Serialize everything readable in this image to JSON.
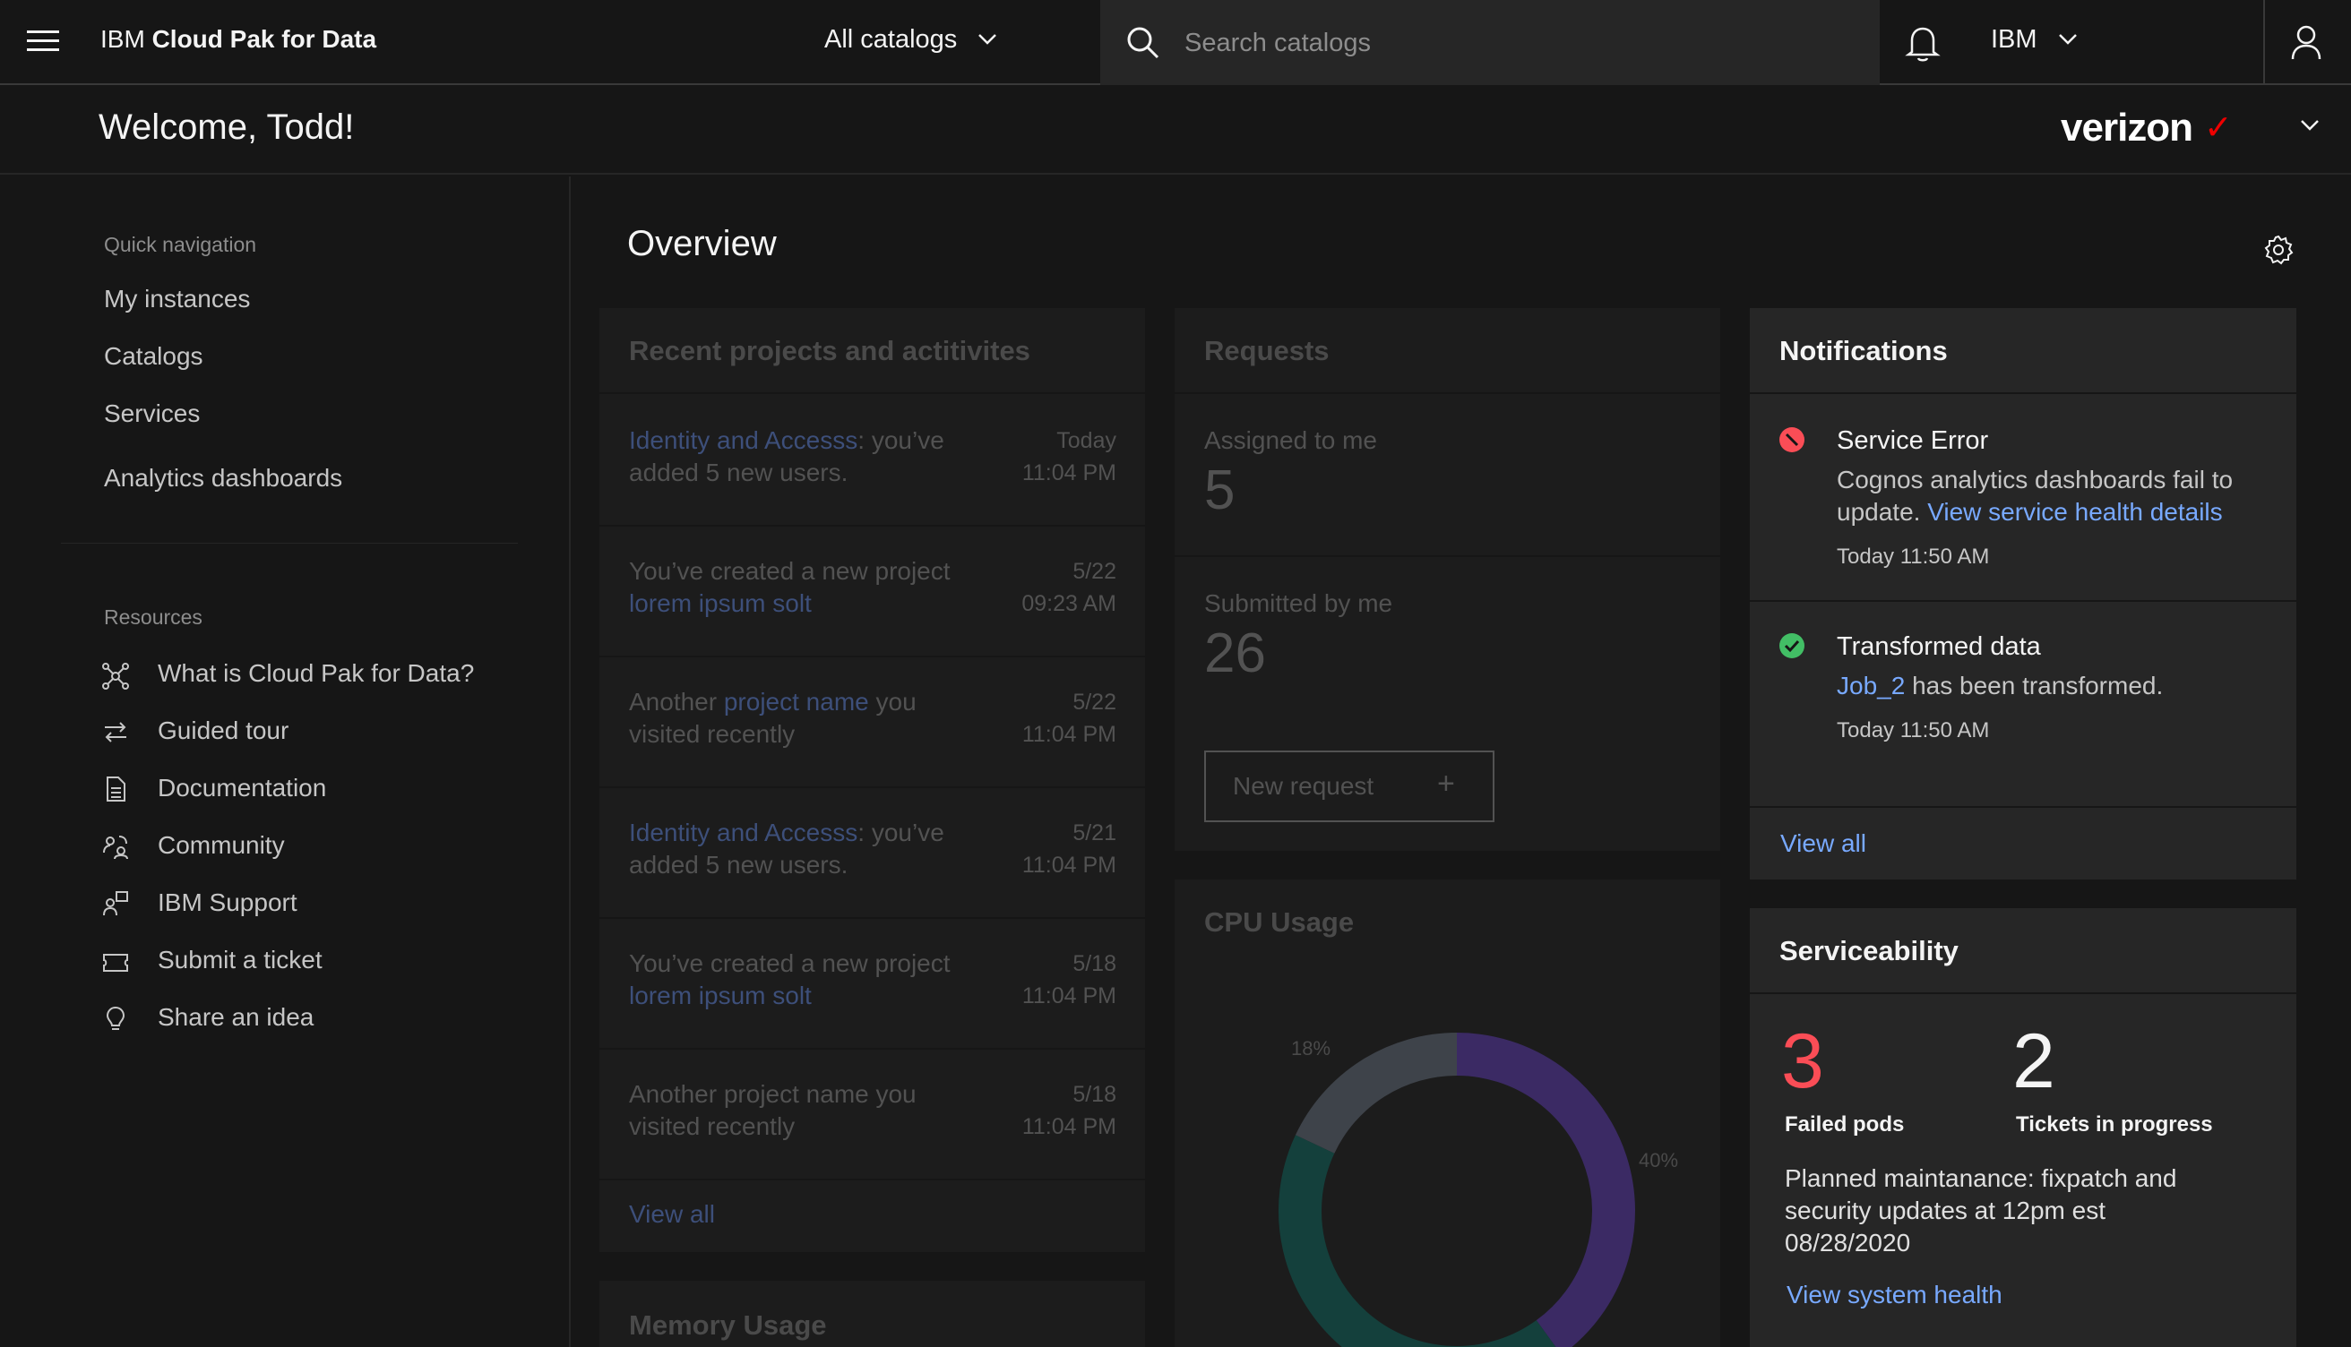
{
  "header": {
    "brand_prefix": "IBM",
    "brand_name": "Cloud Pak for Data",
    "catalog_selector": "All catalogs",
    "search_placeholder": "Search catalogs",
    "tenant": "IBM"
  },
  "welcome": {
    "greeting": "Welcome, Todd!",
    "org_logo_text": "verizon",
    "org_logo_mark": "✓"
  },
  "left_nav": {
    "quick_nav_label": "Quick navigation",
    "quick_items": [
      "My instances",
      "Catalogs",
      "Services",
      "Analytics dashboards"
    ],
    "resources_label": "Resources",
    "resources": [
      {
        "label": "What is Cloud Pak for Data?",
        "icon": "network-icon"
      },
      {
        "label": "Guided tour",
        "icon": "arrows-swap-icon"
      },
      {
        "label": "Documentation",
        "icon": "document-icon"
      },
      {
        "label": "Community",
        "icon": "community-icon"
      },
      {
        "label": "IBM Support",
        "icon": "support-icon"
      },
      {
        "label": "Submit a ticket",
        "icon": "ticket-icon"
      },
      {
        "label": "Share an idea",
        "icon": "lightbulb-icon"
      }
    ]
  },
  "main": {
    "title": "Overview",
    "recent": {
      "title": "Recent projects and actitivites",
      "items": [
        {
          "link": "Identity and Accesss",
          "text_after": ": you’ve added 5 new users.",
          "date": "Today",
          "time": "11:04 PM"
        },
        {
          "text_before": "You’ve created a new project ",
          "link": "lorem ipsum solt",
          "date": "5/22",
          "time": "09:23 AM"
        },
        {
          "text_before": "Another ",
          "link": "project name",
          "text_after": " you visited recently",
          "date": "5/22",
          "time": "11:04 PM"
        },
        {
          "link": "Identity and Accesss",
          "text_after": ": you’ve added 5 new users.",
          "date": "5/21",
          "time": "11:04 PM"
        },
        {
          "text_before": "You’ve created a new project ",
          "link": "lorem ipsum solt",
          "date": "5/18",
          "time": "11:04 PM"
        },
        {
          "text_before": "Another project name you visited recently",
          "date": "5/18",
          "time": "11:04 PM"
        }
      ],
      "view_all": "View all"
    },
    "memory": {
      "title": "Memory Usage"
    },
    "requests": {
      "title": "Requests",
      "assigned_label": "Assigned to me",
      "assigned_value": "5",
      "submitted_label": "Submitted by me",
      "submitted_value": "26",
      "new_request": "New request",
      "new_request_icon": "+"
    },
    "cpu": {
      "title": "CPU Usage",
      "labels": [
        "18%",
        "40%"
      ]
    },
    "notifications": {
      "title": "Notifications",
      "items": [
        {
          "title": "Service Error",
          "body": "Cognos analytics dashboards fail to update. ",
          "link": "View service health details",
          "time": "Today 11:50 AM",
          "status_color": "#fa4d56"
        },
        {
          "title": "Transformed data",
          "link": "Job_2",
          "body": " has been transformed.",
          "time": "Today 11:50 AM",
          "status_color": "#42be65"
        }
      ],
      "view_all": "View all"
    },
    "serviceability": {
      "title": "Serviceability",
      "failed_value": "3",
      "failed_label": "Failed pods",
      "tickets_value": "2",
      "tickets_label": "Tickets in progress",
      "maintenance": "Planned maintanance: fixpatch and security updates at 12pm est 08/28/2020",
      "link": "View system health"
    }
  },
  "chart_data": {
    "type": "pie",
    "title": "CPU Usage",
    "categories": [
      "",
      "",
      ""
    ],
    "values": [
      40,
      42,
      18
    ],
    "printed_labels": [
      "18%",
      "40%"
    ],
    "colors": [
      "#3b2a64",
      "#14403c",
      "#3e434a"
    ]
  },
  "colors": {
    "accent_link": "#78a9ff",
    "error": "#fa4d56",
    "success": "#42be65",
    "brand_check": "#ee0000"
  }
}
